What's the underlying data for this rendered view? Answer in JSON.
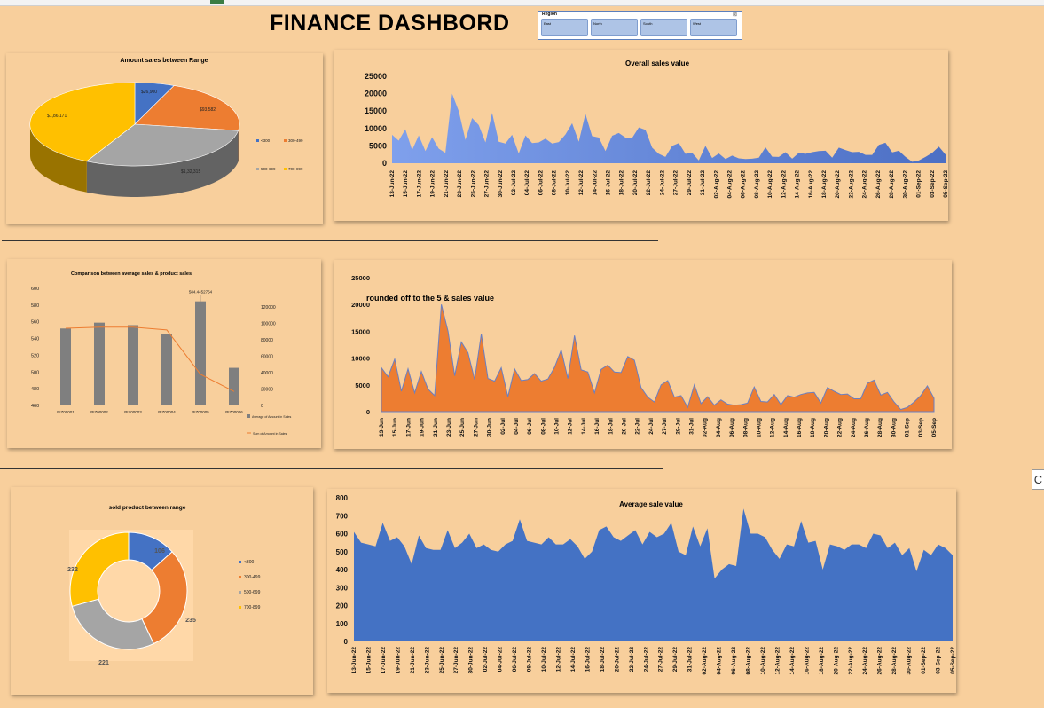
{
  "header": {
    "title": "FINANCE DASHBORD"
  },
  "slicer": {
    "header": "Region",
    "clear_icon": "filter-clear-icon",
    "items": [
      "East",
      "North",
      "South",
      "West"
    ]
  },
  "pie_sales": {
    "title": "Amount sales between Range",
    "labels": [
      "$26,900",
      "$93,582",
      "$1,32,315",
      "$1,86,171"
    ],
    "legend": [
      "<300",
      "300-499",
      "500-699",
      "700-899"
    ],
    "values": [
      26900,
      93582,
      132315,
      186171
    ],
    "colors": [
      "#4472c4",
      "#ed7d31",
      "#a5a5a5",
      "#ffc000"
    ]
  },
  "overall_sales": {
    "title": "Overall sales value",
    "yticks": [
      "25000",
      "20000",
      "15000",
      "10000",
      "5000",
      "0"
    ],
    "xlabels": [
      "13-Jun-22",
      "15-Jun-22",
      "17-Jun-22",
      "19-Jun-22",
      "21-Jun-22",
      "23-Jun-22",
      "25-Jun-22",
      "27-Jun-22",
      "30-Jun-22",
      "02-Jul-22",
      "04-Jul-22",
      "06-Jul-22",
      "08-Jul-22",
      "10-Jul-22",
      "12-Jul-22",
      "14-Jul-22",
      "16-Jul-22",
      "18-Jul-22",
      "20-Jul-22",
      "22-Jul-22",
      "24-Jul-22",
      "27-Jul-22",
      "29-Jul-22",
      "31-Jul-22",
      "02-Aug-22",
      "04-Aug-22",
      "06-Aug-22",
      "08-Aug-22",
      "10-Aug-22",
      "12-Aug-22",
      "14-Aug-22",
      "16-Aug-22",
      "18-Aug-22",
      "20-Aug-22",
      "22-Aug-22",
      "24-Aug-22",
      "26-Aug-22",
      "28-Aug-22",
      "30-Aug-22",
      "01-Sep-22",
      "03-Sep-22",
      "05-Sep-22"
    ]
  },
  "combo_chart": {
    "title": "Comparison between average sales & product sales",
    "left_ticks": [
      "600",
      "580",
      "560",
      "540",
      "520",
      "500",
      "480",
      "460"
    ],
    "right_ticks": [
      "120000",
      "100000",
      "80000",
      "60000",
      "40000",
      "20000",
      "0"
    ],
    "categories": [
      "PIZ00001",
      "PIZ00002",
      "PIZ00003",
      "PIZ00004",
      "PIZ00005",
      "PIZ00006"
    ],
    "bar_values": [
      552,
      559,
      556,
      545,
      584.4452754,
      505
    ],
    "line_values": [
      94000,
      95500,
      95500,
      92000,
      38000,
      17000
    ],
    "annotation": "584.4452754",
    "legend": [
      "Average of Amount in Sales",
      "Sum of Amount in Sales"
    ]
  },
  "rounded_sales": {
    "title": "rounded off to the 5 & sales value",
    "yticks": [
      "25000",
      "20000",
      "15000",
      "10000",
      "5000",
      "0"
    ],
    "xlabels": [
      "13-Jun",
      "15-Jun",
      "17-Jun",
      "19-Jun",
      "21-Jun",
      "23-Jun",
      "25-Jun",
      "27-Jun",
      "30-Jun",
      "02-Jul",
      "04-Jul",
      "06-Jul",
      "08-Jul",
      "10-Jul",
      "12-Jul",
      "14-Jul",
      "16-Jul",
      "18-Jul",
      "20-Jul",
      "22-Jul",
      "24-Jul",
      "27-Jul",
      "29-Jul",
      "31-Jul",
      "02-Aug",
      "04-Aug",
      "06-Aug",
      "08-Aug",
      "10-Aug",
      "12-Aug",
      "14-Aug",
      "16-Aug",
      "18-Aug",
      "20-Aug",
      "22-Aug",
      "24-Aug",
      "26-Aug",
      "28-Aug",
      "30-Aug",
      "01-Sep",
      "03-Sep",
      "05-Sep"
    ]
  },
  "donut": {
    "title": "sold product between range",
    "values": [
      106,
      235,
      221,
      232
    ],
    "labels": [
      "106",
      "235",
      "221",
      "232"
    ],
    "legend": [
      "<300",
      "300-499",
      "500-699",
      "700-899"
    ],
    "colors": [
      "#4472c4",
      "#ed7d31",
      "#a5a5a5",
      "#ffc000"
    ]
  },
  "avg_sale": {
    "title": "Average sale value",
    "yticks": [
      "800",
      "700",
      "600",
      "500",
      "400",
      "300",
      "200",
      "100",
      "0"
    ],
    "xlabels": [
      "13-Jun-22",
      "15-Jun-22",
      "17-Jun-22",
      "19-Jun-22",
      "21-Jun-22",
      "23-Jun-22",
      "25-Jun-22",
      "27-Jun-22",
      "30-Jun-22",
      "02-Jul-22",
      "04-Jul-22",
      "06-Jul-22",
      "08-Jul-22",
      "10-Jul-22",
      "12-Jul-22",
      "14-Jul-22",
      "16-Jul-22",
      "18-Jul-22",
      "20-Jul-22",
      "22-Jul-22",
      "24-Jul-22",
      "27-Jul-22",
      "29-Jul-22",
      "31-Jul-22",
      "02-Aug-22",
      "04-Aug-22",
      "06-Aug-22",
      "08-Aug-22",
      "10-Aug-22",
      "12-Aug-22",
      "14-Aug-22",
      "16-Aug-22",
      "18-Aug-22",
      "20-Aug-22",
      "22-Aug-22",
      "24-Aug-22",
      "26-Aug-22",
      "28-Aug-22",
      "30-Aug-22",
      "01-Sep-22",
      "03-Sep-22",
      "05-Sep-22"
    ]
  },
  "side_button": {
    "label": "C"
  },
  "chart_data": [
    {
      "type": "pie",
      "title": "Amount sales between Range",
      "categories": [
        "<300",
        "300-499",
        "500-699",
        "700-899"
      ],
      "values": [
        26900,
        93582,
        132315,
        186171
      ]
    },
    {
      "type": "area",
      "title": "Overall sales value",
      "ylim": [
        0,
        25000
      ],
      "x": [
        "13-Jun-22",
        "14-Jun-22",
        "15-Jun-22",
        "16-Jun-22",
        "17-Jun-22",
        "18-Jun-22",
        "19-Jun-22",
        "20-Jun-22",
        "21-Jun-22",
        "22-Jun-22",
        "23-Jun-22",
        "24-Jun-22",
        "25-Jun-22",
        "26-Jun-22",
        "27-Jun-22",
        "28-Jun-22",
        "30-Jun-22",
        "01-Jul-22",
        "02-Jul-22",
        "03-Jul-22",
        "04-Jul-22",
        "05-Jul-22",
        "06-Jul-22",
        "07-Jul-22",
        "08-Jul-22",
        "09-Jul-22",
        "10-Jul-22",
        "11-Jul-22",
        "12-Jul-22",
        "13-Jul-22",
        "14-Jul-22",
        "15-Jul-22",
        "16-Jul-22",
        "17-Jul-22",
        "18-Jul-22",
        "19-Jul-22",
        "20-Jul-22",
        "21-Jul-22",
        "22-Jul-22",
        "23-Jul-22",
        "24-Jul-22",
        "26-Jul-22",
        "27-Jul-22",
        "28-Jul-22",
        "29-Jul-22",
        "30-Jul-22",
        "31-Jul-22",
        "01-Aug-22",
        "02-Aug-22",
        "03-Aug-22",
        "04-Aug-22",
        "05-Aug-22",
        "06-Aug-22",
        "07-Aug-22",
        "08-Aug-22",
        "09-Aug-22",
        "10-Aug-22",
        "11-Aug-22",
        "12-Aug-22",
        "13-Aug-22",
        "14-Aug-22",
        "15-Aug-22",
        "16-Aug-22",
        "17-Aug-22",
        "18-Aug-22",
        "19-Aug-22",
        "20-Aug-22",
        "21-Aug-22",
        "22-Aug-22",
        "23-Aug-22",
        "24-Aug-22",
        "25-Aug-22",
        "26-Aug-22",
        "27-Aug-22",
        "28-Aug-22",
        "29-Aug-22",
        "30-Aug-22",
        "31-Aug-22",
        "01-Sep-22",
        "02-Sep-22",
        "03-Sep-22",
        "04-Sep-22",
        "05-Sep-22",
        "06-Sep-22"
      ],
      "values": [
        8200,
        6500,
        9800,
        3800,
        8000,
        3500,
        7500,
        4200,
        3000,
        20000,
        15000,
        6700,
        13000,
        11000,
        6000,
        14500,
        6200,
        5700,
        8200,
        2800,
        8000,
        5800,
        6000,
        7100,
        5700,
        6100,
        8300,
        11500,
        6200,
        14200,
        7800,
        7400,
        3500,
        7900,
        8700,
        7400,
        7300,
        10300,
        9600,
        4500,
        2700,
        1800,
        5000,
        5800,
        2700,
        3000,
        800,
        5000,
        1500,
        2800,
        1200,
        2200,
        1400,
        1200,
        1300,
        1600,
        4600,
        1900,
        1800,
        3200,
        1300,
        3000,
        2700,
        3200,
        3500,
        3600,
        1600,
        4500,
        3800,
        3200,
        3300,
        2400,
        2400,
        5300,
        5900,
        3100,
        3600,
        1800,
        400,
        800,
        1800,
        3000,
        4800,
        2500
      ]
    },
    {
      "type": "bar",
      "title": "Comparison between average sales & product sales",
      "categories": [
        "PIZ00001",
        "PIZ00002",
        "PIZ00003",
        "PIZ00004",
        "PIZ00005",
        "PIZ00006"
      ],
      "ylim": [
        460,
        600
      ],
      "y2lim": [
        0,
        120000
      ],
      "series": [
        {
          "name": "Average of Amount in Sales",
          "values": [
            552,
            559,
            556,
            545,
            584.4452754,
            505
          ]
        },
        {
          "name": "Sum of Amount in Sales",
          "values": [
            94000,
            95500,
            95500,
            92000,
            38000,
            17000
          ]
        }
      ]
    },
    {
      "type": "area",
      "title": "rounded off to the 5 & sales value",
      "ylim": [
        0,
        25000
      ],
      "x": [
        "13-Jun",
        "14-Jun",
        "15-Jun",
        "16-Jun",
        "17-Jun",
        "18-Jun",
        "19-Jun",
        "20-Jun",
        "21-Jun",
        "22-Jun",
        "23-Jun",
        "24-Jun",
        "25-Jun",
        "26-Jun",
        "27-Jun",
        "28-Jun",
        "30-Jun",
        "01-Jul",
        "02-Jul",
        "03-Jul",
        "04-Jul",
        "05-Jul",
        "06-Jul",
        "07-Jul",
        "08-Jul",
        "09-Jul",
        "10-Jul",
        "11-Jul",
        "12-Jul",
        "13-Jul",
        "14-Jul",
        "15-Jul",
        "16-Jul",
        "17-Jul",
        "18-Jul",
        "19-Jul",
        "20-Jul",
        "21-Jul",
        "22-Jul",
        "23-Jul",
        "24-Jul",
        "26-Jul",
        "27-Jul",
        "28-Jul",
        "29-Jul",
        "30-Jul",
        "31-Jul",
        "01-Aug",
        "02-Aug",
        "03-Aug",
        "04-Aug",
        "05-Aug",
        "06-Aug",
        "07-Aug",
        "08-Aug",
        "09-Aug",
        "10-Aug",
        "11-Aug",
        "12-Aug",
        "13-Aug",
        "14-Aug",
        "15-Aug",
        "16-Aug",
        "17-Aug",
        "18-Aug",
        "19-Aug",
        "20-Aug",
        "21-Aug",
        "22-Aug",
        "23-Aug",
        "24-Aug",
        "25-Aug",
        "26-Aug",
        "27-Aug",
        "28-Aug",
        "29-Aug",
        "30-Aug",
        "31-Aug",
        "01-Sep",
        "02-Sep",
        "03-Sep",
        "04-Sep",
        "05-Sep",
        "06-Sep"
      ],
      "values": [
        8200,
        6500,
        9800,
        3800,
        8000,
        3500,
        7500,
        4200,
        3000,
        20000,
        15000,
        6700,
        13000,
        11000,
        6000,
        14500,
        6200,
        5700,
        8200,
        2800,
        8000,
        5800,
        6000,
        7100,
        5700,
        6100,
        8300,
        11500,
        6200,
        14200,
        7800,
        7400,
        3500,
        7900,
        8700,
        7400,
        7300,
        10300,
        9600,
        4500,
        2700,
        1800,
        5000,
        5800,
        2700,
        3000,
        800,
        5000,
        1500,
        2800,
        1200,
        2200,
        1400,
        1200,
        1300,
        1600,
        4600,
        1900,
        1800,
        3200,
        1300,
        3000,
        2700,
        3200,
        3500,
        3600,
        1600,
        4500,
        3800,
        3200,
        3300,
        2400,
        2400,
        5300,
        5900,
        3100,
        3600,
        1800,
        400,
        800,
        1800,
        3000,
        4800,
        2500
      ]
    },
    {
      "type": "pie",
      "title": "sold product between range",
      "categories": [
        "<300",
        "300-499",
        "500-699",
        "700-899"
      ],
      "values": [
        106,
        235,
        221,
        232
      ]
    },
    {
      "type": "area",
      "title": "Average sale value",
      "ylim": [
        0,
        800
      ],
      "x": [
        "13-Jun-22",
        "14-Jun-22",
        "15-Jun-22",
        "16-Jun-22",
        "17-Jun-22",
        "18-Jun-22",
        "19-Jun-22",
        "20-Jun-22",
        "21-Jun-22",
        "22-Jun-22",
        "23-Jun-22",
        "24-Jun-22",
        "25-Jun-22",
        "26-Jun-22",
        "27-Jun-22",
        "28-Jun-22",
        "30-Jun-22",
        "01-Jul-22",
        "02-Jul-22",
        "03-Jul-22",
        "04-Jul-22",
        "05-Jul-22",
        "06-Jul-22",
        "07-Jul-22",
        "08-Jul-22",
        "09-Jul-22",
        "10-Jul-22",
        "11-Jul-22",
        "12-Jul-22",
        "13-Jul-22",
        "14-Jul-22",
        "15-Jul-22",
        "16-Jul-22",
        "17-Jul-22",
        "18-Jul-22",
        "19-Jul-22",
        "20-Jul-22",
        "21-Jul-22",
        "22-Jul-22",
        "23-Jul-22",
        "24-Jul-22",
        "26-Jul-22",
        "27-Jul-22",
        "28-Jul-22",
        "29-Jul-22",
        "30-Jul-22",
        "31-Jul-22",
        "01-Aug-22",
        "02-Aug-22",
        "03-Aug-22",
        "04-Aug-22",
        "05-Aug-22",
        "06-Aug-22",
        "07-Aug-22",
        "08-Aug-22",
        "09-Aug-22",
        "10-Aug-22",
        "11-Aug-22",
        "12-Aug-22",
        "13-Aug-22",
        "14-Aug-22",
        "15-Aug-22",
        "16-Aug-22",
        "17-Aug-22",
        "18-Aug-22",
        "19-Aug-22",
        "20-Aug-22",
        "21-Aug-22",
        "22-Aug-22",
        "23-Aug-22",
        "24-Aug-22",
        "25-Aug-22",
        "26-Aug-22",
        "27-Aug-22",
        "28-Aug-22",
        "29-Aug-22",
        "30-Aug-22",
        "31-Aug-22",
        "01-Sep-22",
        "02-Sep-22",
        "03-Sep-22",
        "04-Sep-22",
        "05-Sep-22",
        "06-Sep-22"
      ],
      "values": [
        610,
        550,
        540,
        530,
        660,
        560,
        580,
        530,
        430,
        590,
        520,
        510,
        510,
        620,
        520,
        550,
        600,
        520,
        540,
        510,
        500,
        540,
        560,
        680,
        560,
        550,
        540,
        580,
        540,
        540,
        570,
        530,
        460,
        500,
        620,
        640,
        580,
        560,
        590,
        620,
        540,
        610,
        580,
        600,
        660,
        500,
        480,
        640,
        530,
        630,
        350,
        400,
        430,
        420,
        740,
        600,
        600,
        580,
        510,
        460,
        540,
        530,
        670,
        550,
        560,
        400,
        540,
        530,
        510,
        540,
        540,
        520,
        600,
        590,
        520,
        550,
        480,
        520,
        390,
        510,
        480,
        540,
        520,
        480
      ]
    }
  ]
}
